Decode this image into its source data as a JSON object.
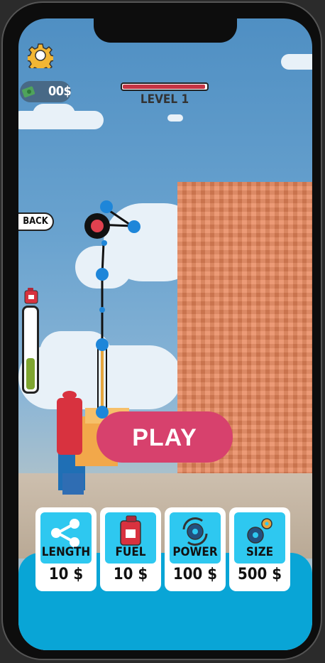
{
  "hud": {
    "money": "00$",
    "level_label": "LEVEL 1",
    "level_progress": 0.97,
    "back_label": "BACK",
    "fuel_level": 0.42
  },
  "play_label": "PLAY",
  "upgrades": [
    {
      "label": "LENGTH",
      "price": "10 $",
      "icon": "share-nodes-icon"
    },
    {
      "label": "FUEL",
      "price": "10 $",
      "icon": "fuel-can-icon"
    },
    {
      "label": "POWER",
      "price": "100 $",
      "icon": "cycle-gear-icon"
    },
    {
      "label": "SIZE",
      "price": "500 $",
      "icon": "gears-icon"
    }
  ],
  "colors": {
    "play": "#d7416d",
    "card_icon_bg": "#2ec8f0",
    "bottom_panel": "#09a5d6",
    "wall": "#e8865a",
    "fuel": "#7fa530",
    "level_fill": "#c53444"
  }
}
